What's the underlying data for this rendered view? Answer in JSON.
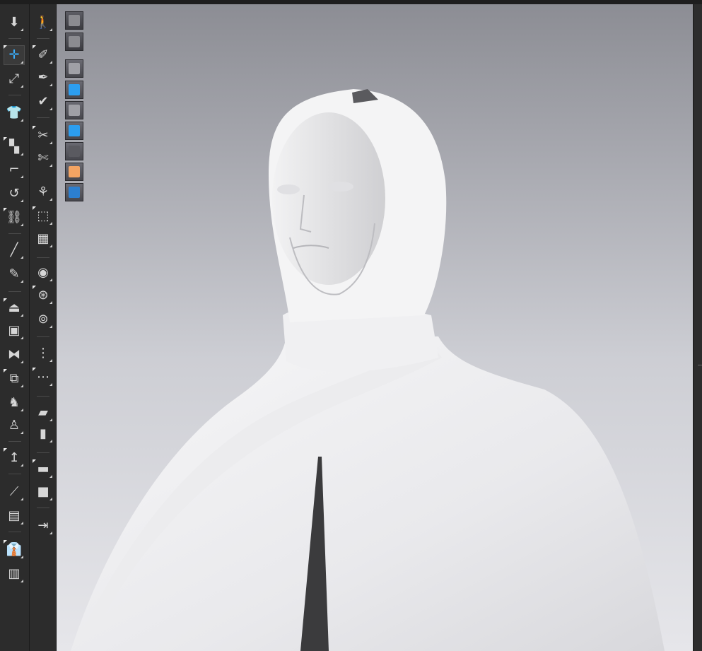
{
  "window": {
    "title": ""
  },
  "colors": {
    "toolbar_bg": "#2c2c2c",
    "accent": "#3ab0ff",
    "viewport_top": "#8c8d94",
    "viewport_bottom": "#e6e6ea",
    "avatar_skin_toggle": "#f3a463"
  },
  "toolbar_left": {
    "tools": [
      {
        "name": "simulation-icon",
        "glyph": "⬇"
      },
      {
        "name": "select-move-icon",
        "glyph": "✛",
        "active": true
      },
      {
        "name": "select-mesh-icon",
        "glyph": "⤢"
      },
      {
        "name": "garment-icon",
        "glyph": "👕"
      },
      {
        "name": "pattern-edit-icon",
        "glyph": "▚"
      },
      {
        "name": "transform-pattern-icon",
        "glyph": "⌐"
      },
      {
        "name": "fold-icon",
        "glyph": "↺"
      },
      {
        "name": "sewing-icon",
        "glyph": "⛓"
      },
      {
        "name": "pin-icon",
        "glyph": "╱"
      },
      {
        "name": "tack-icon",
        "glyph": "✎"
      },
      {
        "name": "avatar-edit-icon",
        "glyph": "⏏"
      },
      {
        "name": "arrangement-icon",
        "glyph": "▣"
      },
      {
        "name": "symmetry-icon",
        "glyph": "⧓"
      },
      {
        "name": "fitting-icon",
        "glyph": "⧉"
      },
      {
        "name": "press-icon",
        "glyph": "♞"
      },
      {
        "name": "avatar-pose-icon",
        "glyph": "♙"
      },
      {
        "name": "size-change-icon",
        "glyph": "↥"
      },
      {
        "name": "measure-icon",
        "glyph": "⟋"
      },
      {
        "name": "tape-icon",
        "glyph": "▤"
      },
      {
        "name": "shirt-grading-icon",
        "glyph": "👔"
      },
      {
        "name": "shirt-layer-icon",
        "glyph": "▥"
      }
    ]
  },
  "toolbar_right": {
    "tools": [
      {
        "name": "walk-icon",
        "glyph": "🚶"
      },
      {
        "name": "brush-icon",
        "glyph": "✐"
      },
      {
        "name": "needle-icon",
        "glyph": "✒"
      },
      {
        "name": "edit-texture-icon",
        "glyph": "✔"
      },
      {
        "name": "trace-icon",
        "glyph": "✂"
      },
      {
        "name": "cut-icon",
        "glyph": "✄"
      },
      {
        "name": "knit-icon",
        "glyph": "⚘"
      },
      {
        "name": "fabric-icon",
        "glyph": "⬚"
      },
      {
        "name": "graphic-icon",
        "glyph": "▦"
      },
      {
        "name": "button-add-icon",
        "glyph": "◉"
      },
      {
        "name": "button-icon",
        "glyph": "⊛"
      },
      {
        "name": "buttonhole-icon",
        "glyph": "⊚"
      },
      {
        "name": "zipper-icon",
        "glyph": "⋮"
      },
      {
        "name": "zipper-slider-icon",
        "glyph": "⋯"
      },
      {
        "name": "puckering-icon",
        "glyph": "▰"
      },
      {
        "name": "panel-icon",
        "glyph": "▮"
      },
      {
        "name": "binding-icon",
        "glyph": "▬"
      },
      {
        "name": "block-icon",
        "glyph": "■"
      },
      {
        "name": "merge-icon",
        "glyph": "⇥"
      }
    ]
  },
  "viewport_controls": {
    "buttons": [
      {
        "name": "view-3d-garment-icon"
      },
      {
        "name": "view-garment-outline-icon"
      },
      {
        "name": "show-garment-icon"
      },
      {
        "name": "show-texture-icon"
      },
      {
        "name": "show-avatar-icon"
      },
      {
        "name": "show-fabric-icon"
      },
      {
        "name": "show-shading-icon"
      },
      {
        "name": "show-skin-icon"
      },
      {
        "name": "show-environment-icon"
      }
    ]
  }
}
